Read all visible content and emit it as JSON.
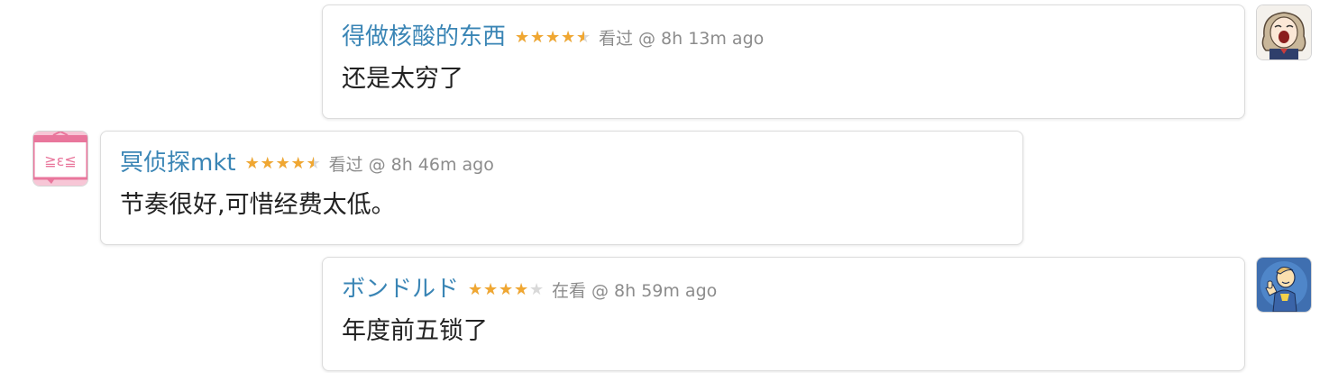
{
  "colors": {
    "username": "#3a85b5",
    "star_filled": "#f0a732",
    "star_empty": "#d9d9d9",
    "meta_text": "#8c8c8c",
    "comment_text": "#222222",
    "card_border": "#dcdcdc"
  },
  "comments": [
    {
      "side": "right",
      "username": "得做核酸的东西",
      "rating": 4.5,
      "status": "看过",
      "time": "8h 13m ago",
      "text": "还是太穷了",
      "avatar_icon": "anime-girl-avatar-icon"
    },
    {
      "side": "left",
      "username": "冥侦探mkt",
      "rating": 4.5,
      "status": "看过",
      "time": "8h 46m ago",
      "text": "节奏很好,可惜经费太低。",
      "avatar_icon": "pink-tv-avatar-icon"
    },
    {
      "side": "right",
      "username": "ボンドルド",
      "rating": 4,
      "status": "在看",
      "time": "8h 59m ago",
      "text": "年度前五锁了",
      "avatar_icon": "vault-boy-avatar-icon"
    }
  ],
  "at_symbol": "@"
}
